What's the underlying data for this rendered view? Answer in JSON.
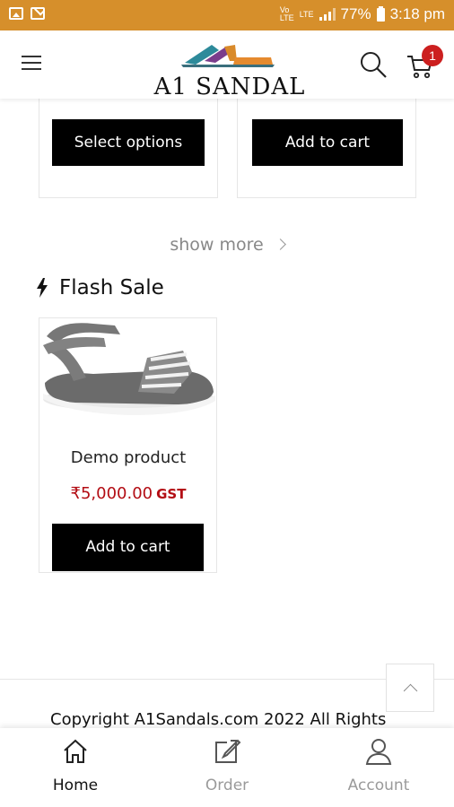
{
  "status_bar": {
    "lte_label": "LTE",
    "battery": "77%",
    "time": "3:18 pm"
  },
  "header": {
    "brand": "A1 SANDAL",
    "cart_count": "1"
  },
  "product_row": {
    "left_button": "Select options",
    "right_button": "Add to cart"
  },
  "show_more": "show more",
  "flash_sale": {
    "title": "Flash Sale",
    "product": {
      "name": "Demo product",
      "price": "₹5,000.00",
      "tax_label": "GST",
      "button": "Add to cart"
    }
  },
  "footer": {
    "copyright": "Copyright A1Sandals.com 2022 All Rights"
  },
  "bottom_nav": {
    "items": [
      {
        "label": "Home",
        "icon": "home-icon",
        "active": true
      },
      {
        "label": "Order",
        "icon": "edit-icon",
        "active": false
      },
      {
        "label": "Account",
        "icon": "user-icon",
        "active": false
      }
    ]
  },
  "colors": {
    "status_bar": "#d68f2b",
    "price": "#b30d14",
    "badge": "#cc1f1f",
    "button": "#000000",
    "inactive_nav": "#9a9a9a"
  }
}
